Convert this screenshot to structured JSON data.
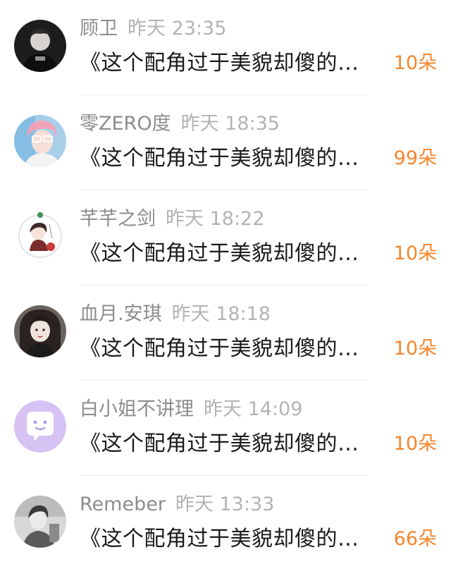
{
  "list": {
    "items": [
      {
        "username": "顾卫",
        "time": "昨天 23:35",
        "title": "《这个配角过于美貌却傻的…",
        "count": "10朵",
        "avatar_icon": "avatar-dark-portrait-icon"
      },
      {
        "username": "零ZERO度",
        "time": "昨天 18:35",
        "title": "《这个配角过于美貌却傻的…",
        "count": "99朵",
        "avatar_icon": "avatar-anime-glasses-icon"
      },
      {
        "username": "芊芊之剑",
        "time": "昨天 18:22",
        "title": "《这个配角过于美貌却傻的…",
        "count": "10朵",
        "avatar_icon": "avatar-chibi-character-icon"
      },
      {
        "username": "血月.安琪",
        "time": "昨天 18:18",
        "title": "《这个配角过于美貌却傻的…",
        "count": "10朵",
        "avatar_icon": "avatar-gothic-portrait-icon"
      },
      {
        "username": "白小姐不讲理",
        "time": "昨天 14:09",
        "title": "《这个配角过于美貌却傻的…",
        "count": "10朵",
        "avatar_icon": "avatar-default-chat-icon"
      },
      {
        "username": "Remeber",
        "time": "昨天 13:33",
        "title": "《这个配角过于美貌却傻的…",
        "count": "66朵",
        "avatar_icon": "avatar-grey-portrait-icon"
      }
    ]
  },
  "colors": {
    "count_accent": "#f4862d",
    "username": "#8c8c8c",
    "time": "#b3b3b3",
    "title": "#1a1a1a",
    "default_avatar_bg": "#d6c3f4"
  }
}
